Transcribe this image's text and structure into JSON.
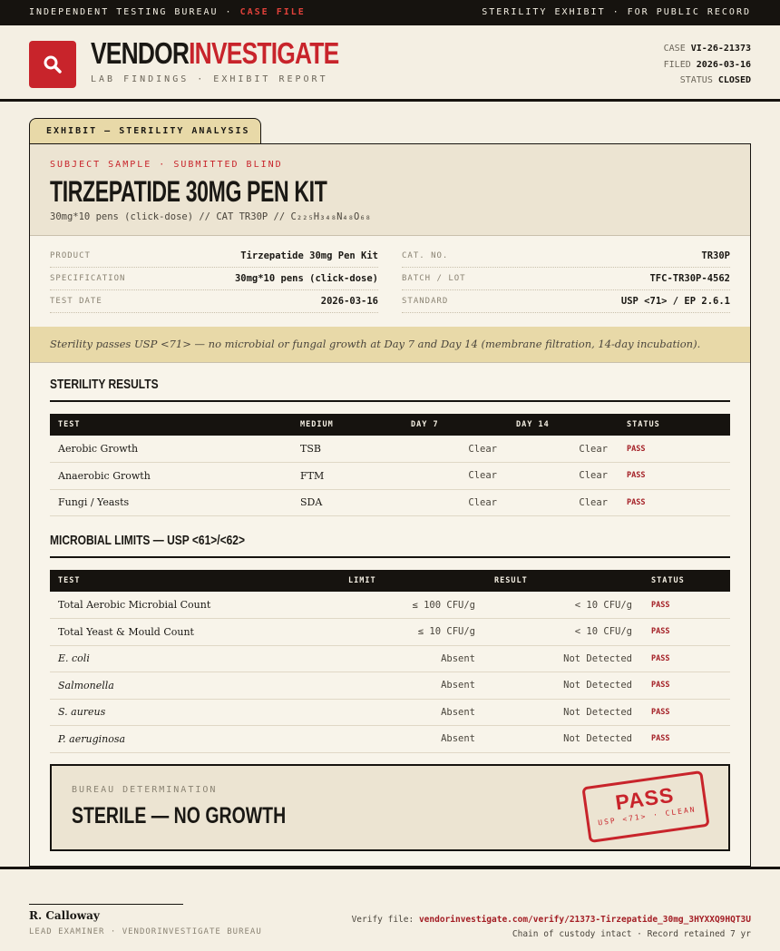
{
  "topbar": {
    "left": "INDEPENDENT TESTING BUREAU ·",
    "left_accent": "CASE FILE",
    "right": "STERILITY EXHIBIT · FOR PUBLIC RECORD"
  },
  "header": {
    "brand_a": "VENDOR",
    "brand_b": "INVESTIGATE",
    "tagline": "LAB FINDINGS · EXHIBIT REPORT",
    "case_label": "CASE",
    "case": "VI-26-21373",
    "filed_label": "FILED",
    "filed": "2026-03-16",
    "status_label": "STATUS",
    "status": "CLOSED"
  },
  "exhibit_tab": "EXHIBIT — STERILITY ANALYSIS",
  "subject": {
    "kicker": "SUBJECT SAMPLE · SUBMITTED BLIND",
    "title": "TIRZEPATIDE 30MG PEN KIT",
    "line": "30mg*10 pens (click-dose)  //  CAT TR30P  //  C₂₂₅H₃₄₈N₄₈O₆₈"
  },
  "specs": {
    "product_k": "PRODUCT",
    "product_v": "Tirzepatide 30mg Pen Kit",
    "spec_k": "SPECIFICATION",
    "spec_v": "30mg*10 pens (click-dose)",
    "date_k": "TEST DATE",
    "date_v": "2026-03-16",
    "cat_k": "CAT. NO.",
    "cat_v": "TR30P",
    "batch_k": "BATCH / LOT",
    "batch_v": "TFC-TR30P-4562",
    "std_k": "STANDARD",
    "std_v": "USP <71> / EP 2.6.1"
  },
  "note": "Sterility passes USP <71> — no microbial or fungal growth at Day 7 and Day 14 (membrane filtration, 14-day incubation).",
  "sterility": {
    "heading": "STERILITY RESULTS",
    "cols": [
      "TEST",
      "MEDIUM",
      "DAY 7",
      "DAY 14",
      "STATUS"
    ],
    "rows": [
      {
        "test": "Aerobic Growth",
        "medium": "TSB",
        "d7": "Clear",
        "d14": "Clear",
        "status": "PASS"
      },
      {
        "test": "Anaerobic Growth",
        "medium": "FTM",
        "d7": "Clear",
        "d14": "Clear",
        "status": "PASS"
      },
      {
        "test": "Fungi / Yeasts",
        "medium": "SDA",
        "d7": "Clear",
        "d14": "Clear",
        "status": "PASS"
      }
    ]
  },
  "limits": {
    "heading": "MICROBIAL LIMITS — USP <61>/<62>",
    "cols": [
      "TEST",
      "LIMIT",
      "RESULT",
      "STATUS"
    ],
    "rows": [
      {
        "test": "Total Aerobic Microbial Count",
        "limit": "≤ 100 CFU/g",
        "result": "< 10 CFU/g",
        "status": "PASS"
      },
      {
        "test": "Total Yeast & Mould Count",
        "limit": "≤ 10 CFU/g",
        "result": "< 10 CFU/g",
        "status": "PASS"
      },
      {
        "test": "E. coli",
        "limit": "Absent",
        "result": "Not Detected",
        "status": "PASS"
      },
      {
        "test": "Salmonella",
        "limit": "Absent",
        "result": "Not Detected",
        "status": "PASS"
      },
      {
        "test": "S. aureus",
        "limit": "Absent",
        "result": "Not Detected",
        "status": "PASS"
      },
      {
        "test": "P. aeruginosa",
        "limit": "Absent",
        "result": "Not Detected",
        "status": "PASS"
      }
    ]
  },
  "determination": {
    "label": "BUREAU DETERMINATION",
    "value": "STERILE — NO GROWTH",
    "stamp": "PASS",
    "stamp_sub": "USP <71> · CLEAN"
  },
  "footer": {
    "name": "R. Calloway",
    "role": "LEAD EXAMINER · VENDORINVESTIGATE BUREAU",
    "verify_label": "Verify file:",
    "verify_url": "vendorinvestigate.com/verify/21373-Tirzepatide_30mg_3HYXXQ9HQT3U",
    "custody": "Chain of custody intact · Record retained 7 yr"
  },
  "icons": {
    "logo": "magnifier-icon"
  },
  "colors": {
    "accent": "#c8242b",
    "ink": "#16130f",
    "paper": "#f4efe3",
    "highlight": "#e8d9a8"
  }
}
